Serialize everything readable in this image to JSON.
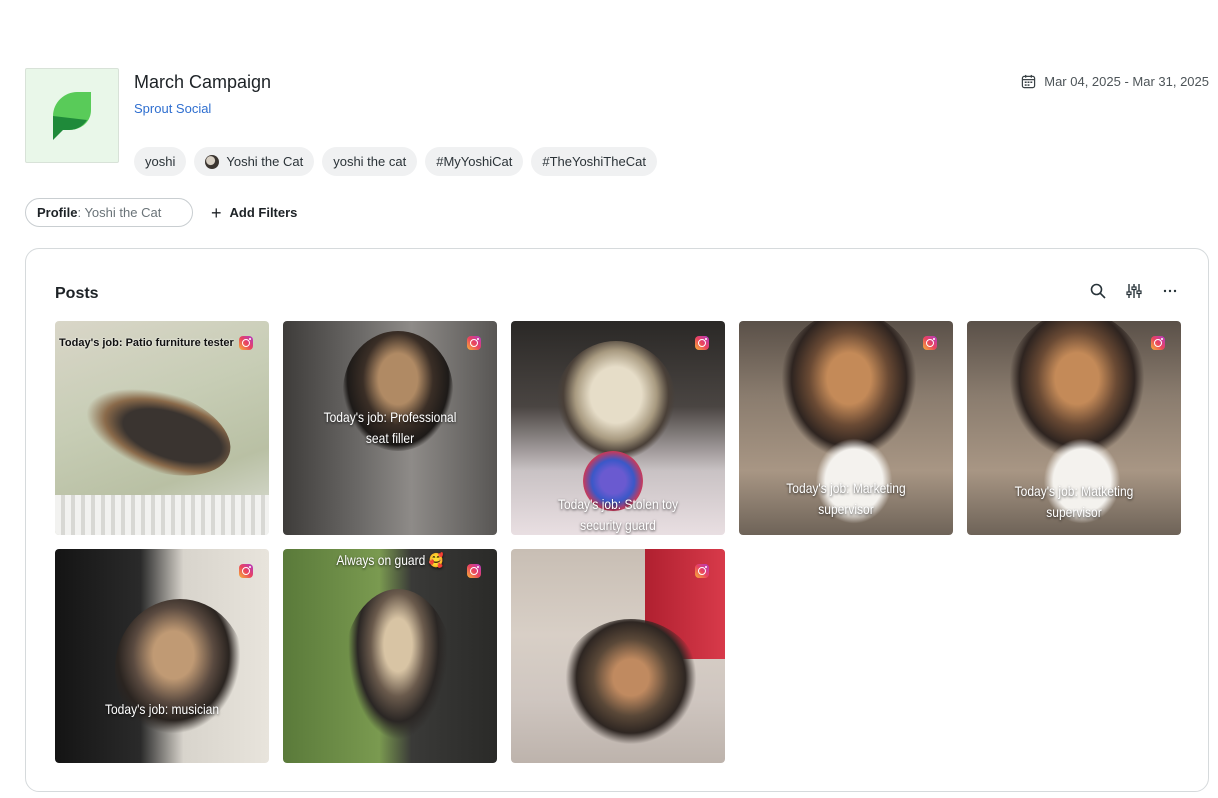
{
  "campaign": {
    "title": "March Campaign",
    "brand": "Sprout Social",
    "date_range": "Mar 04, 2025 - Mar 31, 2025",
    "tags": [
      "yoshi",
      "Yoshi the Cat",
      "yoshi the cat",
      "#MyYoshiCat",
      "#TheYoshiTheCat"
    ]
  },
  "filters": {
    "profile_label": "Profile",
    "profile_value": ": Yoshi the Cat",
    "add_label": "Add Filters"
  },
  "posts_panel": {
    "title": "Posts",
    "posts": [
      {
        "caption": "Today's job: Patio furniture tester",
        "network": "instagram-icon"
      },
      {
        "caption": "Today's job: Professional seat filler",
        "network": "instagram-icon"
      },
      {
        "caption": "Today's job: Stolen toy security guard",
        "network": "instagram-icon"
      },
      {
        "caption": "Today's job: Marketing supervisor",
        "network": "instagram-icon"
      },
      {
        "caption": "Today's job: Matketing supervisor",
        "network": "instagram-icon"
      },
      {
        "caption": "Today's job: musician",
        "network": "instagram-icon"
      },
      {
        "caption": "Always on guard 🥰",
        "network": "instagram-icon"
      },
      {
        "caption": "",
        "network": "instagram-icon"
      }
    ]
  },
  "colors": {
    "brand_green": "#59cb59",
    "link_blue": "#2f6fd0"
  }
}
